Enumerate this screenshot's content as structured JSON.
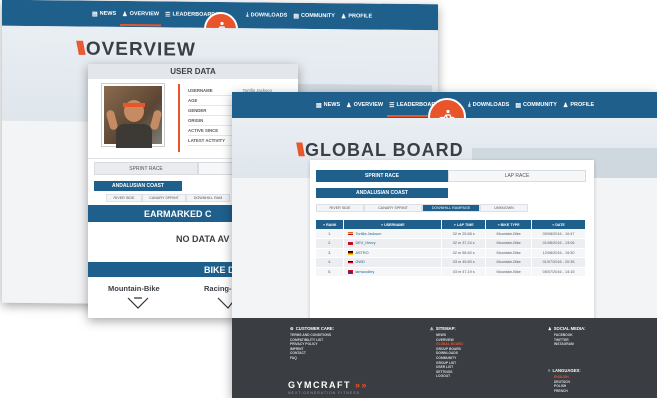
{
  "colors": {
    "nav_blue": "#1f5f8c",
    "accent": "#e8552a",
    "footer": "#3a3d42"
  },
  "nav": {
    "news": "NEWS",
    "overview": "OVERVIEW",
    "leaderboards": "LEADERBOARDS",
    "downloads": "DOWNLOADS",
    "community": "COMMUNITY",
    "profile": "PROFILE"
  },
  "overview_page": {
    "title": "OVERVIEW",
    "user_data": {
      "title": "USER DATA",
      "fields": [
        {
          "label": "USERNAME",
          "value": "Tortilla Jackson"
        },
        {
          "label": "AGE",
          "value": ""
        },
        {
          "label": "GENDER",
          "value": ""
        },
        {
          "label": "ORIGIN",
          "value": ""
        },
        {
          "label": "ACTIVE SINCE",
          "value": ""
        },
        {
          "label": "LATEST ACTIVITY",
          "value": ""
        }
      ]
    },
    "race_tabs": [
      "SPRINT RACE",
      "LAP RAC"
    ],
    "area_tab": "ANDALUSIAN COAST",
    "subtabs": [
      "RIVER SIDE",
      "CANARY SPRINT",
      "DOWNHILL RAM"
    ],
    "earmarked_title": "EARMARKED C",
    "no_data": "NO DATA AV",
    "bikes_title": "BIKE D",
    "bikes": [
      "Mountain-Bike",
      "Racing-"
    ]
  },
  "global_board": {
    "title": "GLOBAL BOARD",
    "race_tabs": [
      "SPRINT RACE",
      "LAP RACE"
    ],
    "area_tab": "ANDALUSIAN COAST",
    "subtabs": [
      "RIVER SIDE",
      "CANARY SPRINT",
      "DOWNHILL RAMPAGE",
      "UNKNOWN"
    ],
    "columns": [
      "≡ RANK",
      "≡ USERNAME",
      "≡ LAP TIME",
      "≡ BIKE TYPE",
      "≡ DATE"
    ],
    "rows": [
      {
        "rank": "1.",
        "flag": "es",
        "username": "Tortilla Jackson",
        "lap_time": "02 m 25.68 s",
        "bike": "Mountain-Bike",
        "date": "09/08/2016 - 10:47"
      },
      {
        "rank": "2.",
        "flag": "gb",
        "username": "DEV_Henry",
        "lap_time": "02 m 37.24 s",
        "bike": "Mountain-Bike",
        "date": "01/08/2016 - 13:06"
      },
      {
        "rank": "3.",
        "flag": "de",
        "username": "ASTRO",
        "lap_time": "02 m 58.40 s",
        "bike": "Mountain-Bike",
        "date": "12/08/2016 - 19:30"
      },
      {
        "rank": "4.",
        "flag": "de",
        "username": "GWD",
        "lap_time": "03 m 45.83 s",
        "bike": "Mountain-Bike",
        "date": "01/07/2016 - 20:35"
      },
      {
        "rank": "5.",
        "flag": "gb",
        "username": "lamwoolley",
        "lap_time": "03 m 47.19 s",
        "bike": "Mountain-Bike",
        "date": "05/07/2016 - 14:15"
      }
    ]
  },
  "footer": {
    "customer_care": {
      "title": "CUSTOMER CARE:",
      "links": [
        "TERMS AND CONDITIONS",
        "COMPATIBILITY LIST",
        "PRIVACY POLICY",
        "IMPRINT",
        "CONTACT",
        "FAQ"
      ]
    },
    "sitemap": {
      "title": "SITEMAP:",
      "links": [
        "NEWS",
        "OVERVIEW",
        "GLOBAL BOARD",
        "GROUP BOARD",
        "DOWNLOADS",
        "COMMUNITY",
        "GROUP LIST",
        "USER LIST",
        "SETTINGS",
        "LOGOUT"
      ],
      "active": "GLOBAL BOARD"
    },
    "social": {
      "title": "SOCIAL MEDIA:",
      "links": [
        "FACEBOOK",
        "TWITTER",
        "INSTAGRAM"
      ]
    },
    "languages": {
      "title": "LANGUAGES:",
      "links": [
        "ENGLISH",
        "DEUTSCH",
        "POLISH",
        "FRENCH"
      ],
      "active": "ENGLISH"
    },
    "logo": "GYMCRAFT",
    "logo_tagline": "NEXT-GENERATION FITNESS"
  }
}
